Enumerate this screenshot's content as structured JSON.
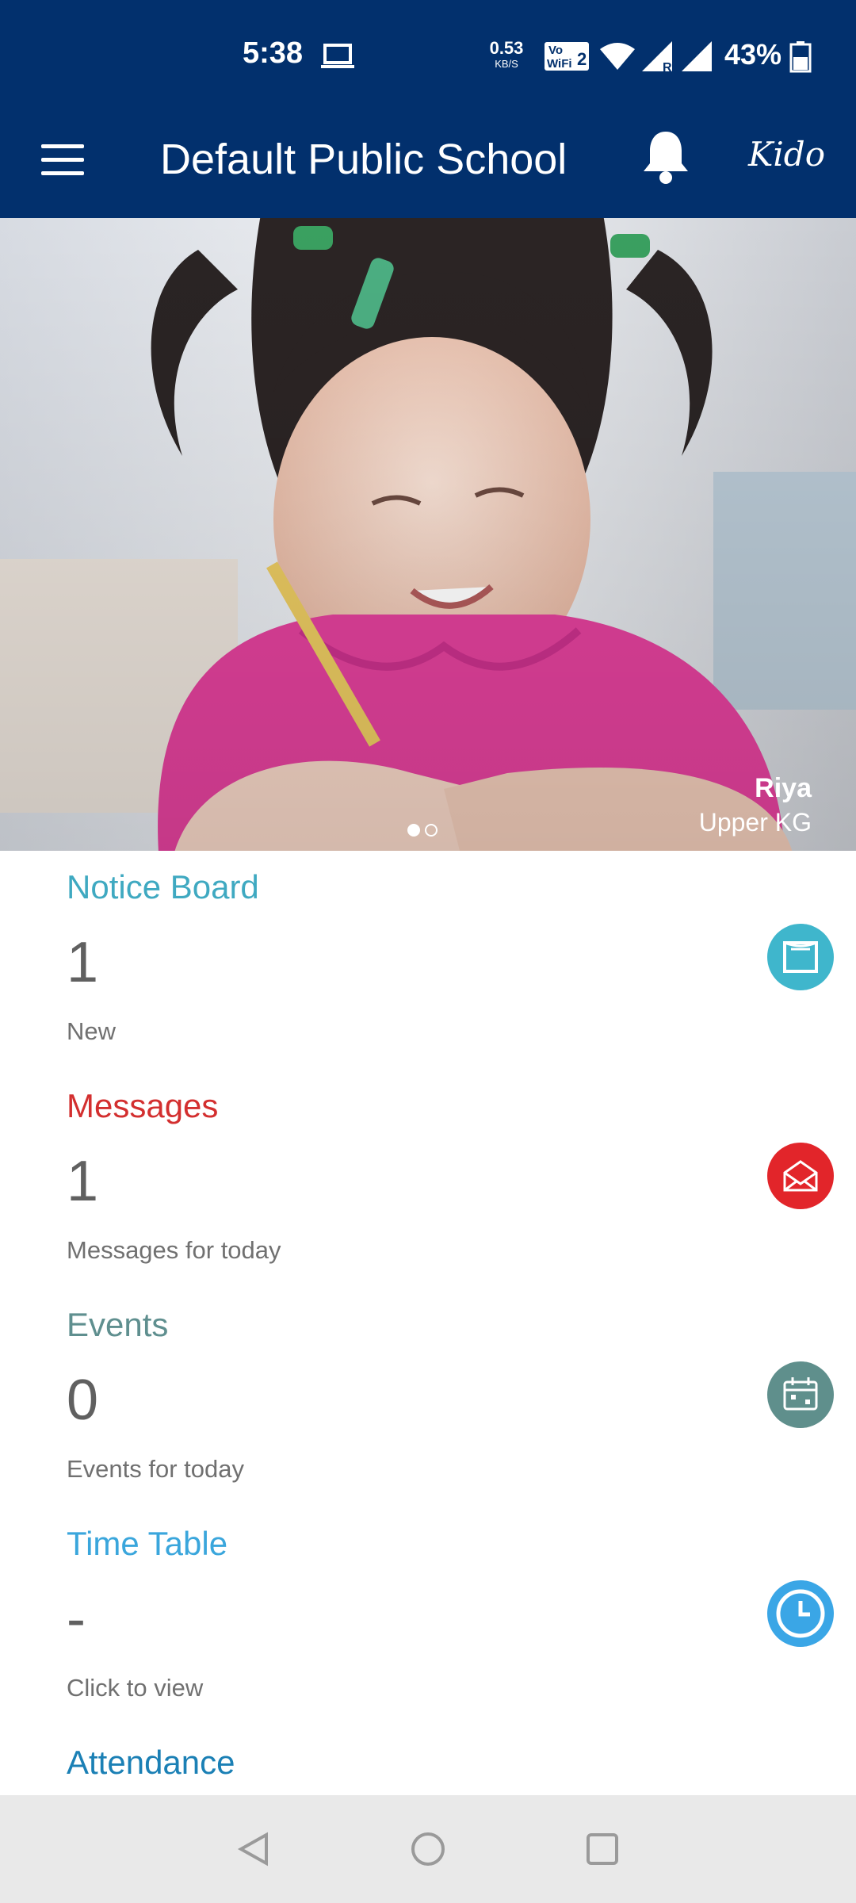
{
  "status_bar": {
    "time": "5:38",
    "net_speed_value": "0.53",
    "net_speed_unit": "KB/S",
    "vowifi_top": "Vo",
    "vowifi_bottom": "WiFi",
    "vowifi_sim": "2",
    "roaming": "R",
    "battery": "43%"
  },
  "app_bar": {
    "title": "Default Public School",
    "brand": "Kido"
  },
  "hero": {
    "student_name": "Riya",
    "student_class": "Upper KG",
    "slide_count": 2,
    "active_slide": 1
  },
  "cards": [
    {
      "title": "Notice Board",
      "value": "1",
      "subtitle": "New",
      "color": "#3fa9c1",
      "icon": "notice-board-icon"
    },
    {
      "title": "Messages",
      "value": "1",
      "subtitle": "Messages for today",
      "color": "#d32f2f",
      "icon": "envelope-icon"
    },
    {
      "title": "Events",
      "value": "0",
      "subtitle": "Events for today",
      "color": "#5f8f8f",
      "icon": "calendar-icon"
    },
    {
      "title": "Time Table",
      "value": "-",
      "subtitle": "Click to view",
      "color": "#3aa6dc",
      "icon": "clock-icon"
    },
    {
      "title": "Attendance",
      "color": "#1b80b5"
    }
  ],
  "colors": {
    "header": "#02306d",
    "nav_bar": "#e9e9e9",
    "divider": "#d0d0d0"
  }
}
